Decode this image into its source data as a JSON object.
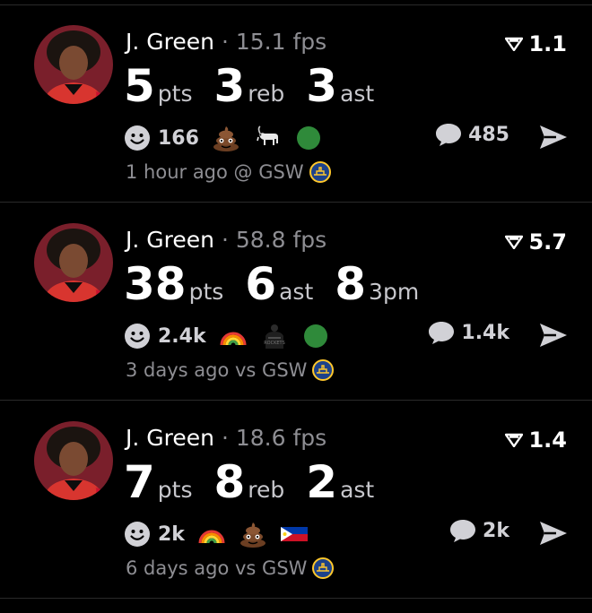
{
  "posts": [
    {
      "player": "J. Green",
      "separator": "·",
      "fps": "15.1 fps",
      "score": "1.1",
      "stats": [
        {
          "value": "5",
          "unit": "pts"
        },
        {
          "value": "3",
          "unit": "reb"
        },
        {
          "value": "3",
          "unit": "ast"
        }
      ],
      "reaction_count": "166",
      "reaction_icons": [
        "poop-emoji",
        "goat-emoji",
        "green-circle-emoji"
      ],
      "comment_count": "485",
      "time_text": "1 hour ago @ GSW",
      "opponent_logo": "gsw-logo"
    },
    {
      "player": "J. Green",
      "separator": "·",
      "fps": "58.8 fps",
      "score": "5.7",
      "stats": [
        {
          "value": "38",
          "unit": "pts"
        },
        {
          "value": "6",
          "unit": "ast"
        },
        {
          "value": "8",
          "unit": "3pm"
        }
      ],
      "reaction_count": "2.4k",
      "reaction_icons": [
        "rainbow-emoji",
        "player-jersey-emoji",
        "green-circle-emoji"
      ],
      "comment_count": "1.4k",
      "time_text": "3 days ago vs GSW",
      "opponent_logo": "gsw-logo"
    },
    {
      "player": "J. Green",
      "separator": "·",
      "fps": "18.6 fps",
      "score": "1.4",
      "stats": [
        {
          "value": "7",
          "unit": "pts"
        },
        {
          "value": "8",
          "unit": "reb"
        },
        {
          "value": "2",
          "unit": "ast"
        }
      ],
      "reaction_count": "2k",
      "reaction_icons": [
        "rainbow-emoji",
        "poop-emoji",
        "philippines-flag-emoji"
      ],
      "comment_count": "2k",
      "time_text": "6 days ago vs GSW",
      "opponent_logo": "gsw-logo"
    }
  ],
  "colors": {
    "background": "#000000",
    "primary_text": "#ffffff",
    "secondary_text": "#8e8e93",
    "team_red": "#c8102e",
    "gsw_blue": "#1d428a",
    "gsw_gold": "#ffc72c",
    "green_circle": "#2f8a3a"
  }
}
